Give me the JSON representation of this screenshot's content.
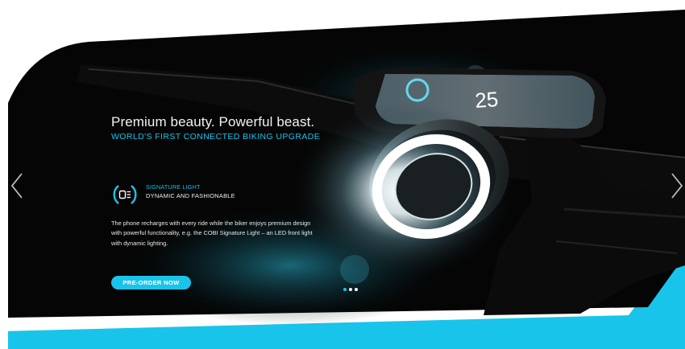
{
  "slide": {
    "headline": "Premium beauty. Powerful beast.",
    "subheadline": "WORLD'S FIRST CONNECTED BIKING UPGRADE",
    "feature": {
      "title": "SIGNATURE LIGHT",
      "subtitle": "DYNAMIC AND FASHIONABLE",
      "icon": "signature-light-icon"
    },
    "description": "The phone recharges with every ride while the biker enjoys premium design with powerful functionality, e.g. the COBI Signature Light – an LED front light with dynamic lighting.",
    "cta_label": "PRE-ORDER NOW",
    "phone_display": "25"
  },
  "carousel": {
    "prev_icon": "chevron-left-icon",
    "next_icon": "chevron-right-icon",
    "active_index": 1,
    "count": 2
  },
  "colors": {
    "accent": "#19c4ea",
    "panel": "#050505",
    "background": "#ffffff"
  }
}
